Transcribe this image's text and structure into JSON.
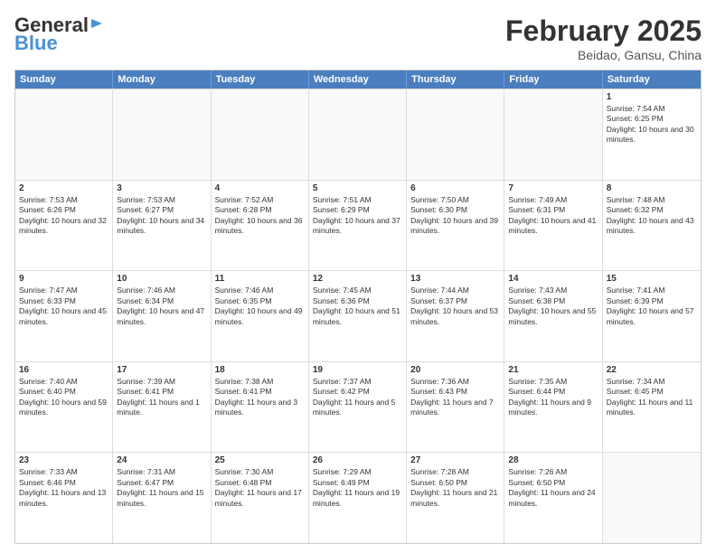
{
  "header": {
    "logo_general": "General",
    "logo_blue": "Blue",
    "month": "February 2025",
    "location": "Beidao, Gansu, China"
  },
  "weekdays": [
    "Sunday",
    "Monday",
    "Tuesday",
    "Wednesday",
    "Thursday",
    "Friday",
    "Saturday"
  ],
  "weeks": [
    [
      {
        "day": "",
        "info": ""
      },
      {
        "day": "",
        "info": ""
      },
      {
        "day": "",
        "info": ""
      },
      {
        "day": "",
        "info": ""
      },
      {
        "day": "",
        "info": ""
      },
      {
        "day": "",
        "info": ""
      },
      {
        "day": "1",
        "info": "Sunrise: 7:54 AM\nSunset: 6:25 PM\nDaylight: 10 hours and 30 minutes."
      }
    ],
    [
      {
        "day": "2",
        "info": "Sunrise: 7:53 AM\nSunset: 6:26 PM\nDaylight: 10 hours and 32 minutes."
      },
      {
        "day": "3",
        "info": "Sunrise: 7:53 AM\nSunset: 6:27 PM\nDaylight: 10 hours and 34 minutes."
      },
      {
        "day": "4",
        "info": "Sunrise: 7:52 AM\nSunset: 6:28 PM\nDaylight: 10 hours and 36 minutes."
      },
      {
        "day": "5",
        "info": "Sunrise: 7:51 AM\nSunset: 6:29 PM\nDaylight: 10 hours and 37 minutes."
      },
      {
        "day": "6",
        "info": "Sunrise: 7:50 AM\nSunset: 6:30 PM\nDaylight: 10 hours and 39 minutes."
      },
      {
        "day": "7",
        "info": "Sunrise: 7:49 AM\nSunset: 6:31 PM\nDaylight: 10 hours and 41 minutes."
      },
      {
        "day": "8",
        "info": "Sunrise: 7:48 AM\nSunset: 6:32 PM\nDaylight: 10 hours and 43 minutes."
      }
    ],
    [
      {
        "day": "9",
        "info": "Sunrise: 7:47 AM\nSunset: 6:33 PM\nDaylight: 10 hours and 45 minutes."
      },
      {
        "day": "10",
        "info": "Sunrise: 7:46 AM\nSunset: 6:34 PM\nDaylight: 10 hours and 47 minutes."
      },
      {
        "day": "11",
        "info": "Sunrise: 7:46 AM\nSunset: 6:35 PM\nDaylight: 10 hours and 49 minutes."
      },
      {
        "day": "12",
        "info": "Sunrise: 7:45 AM\nSunset: 6:36 PM\nDaylight: 10 hours and 51 minutes."
      },
      {
        "day": "13",
        "info": "Sunrise: 7:44 AM\nSunset: 6:37 PM\nDaylight: 10 hours and 53 minutes."
      },
      {
        "day": "14",
        "info": "Sunrise: 7:43 AM\nSunset: 6:38 PM\nDaylight: 10 hours and 55 minutes."
      },
      {
        "day": "15",
        "info": "Sunrise: 7:41 AM\nSunset: 6:39 PM\nDaylight: 10 hours and 57 minutes."
      }
    ],
    [
      {
        "day": "16",
        "info": "Sunrise: 7:40 AM\nSunset: 6:40 PM\nDaylight: 10 hours and 59 minutes."
      },
      {
        "day": "17",
        "info": "Sunrise: 7:39 AM\nSunset: 6:41 PM\nDaylight: 11 hours and 1 minute."
      },
      {
        "day": "18",
        "info": "Sunrise: 7:38 AM\nSunset: 6:41 PM\nDaylight: 11 hours and 3 minutes."
      },
      {
        "day": "19",
        "info": "Sunrise: 7:37 AM\nSunset: 6:42 PM\nDaylight: 11 hours and 5 minutes."
      },
      {
        "day": "20",
        "info": "Sunrise: 7:36 AM\nSunset: 6:43 PM\nDaylight: 11 hours and 7 minutes."
      },
      {
        "day": "21",
        "info": "Sunrise: 7:35 AM\nSunset: 6:44 PM\nDaylight: 11 hours and 9 minutes."
      },
      {
        "day": "22",
        "info": "Sunrise: 7:34 AM\nSunset: 6:45 PM\nDaylight: 11 hours and 11 minutes."
      }
    ],
    [
      {
        "day": "23",
        "info": "Sunrise: 7:33 AM\nSunset: 6:46 PM\nDaylight: 11 hours and 13 minutes."
      },
      {
        "day": "24",
        "info": "Sunrise: 7:31 AM\nSunset: 6:47 PM\nDaylight: 11 hours and 15 minutes."
      },
      {
        "day": "25",
        "info": "Sunrise: 7:30 AM\nSunset: 6:48 PM\nDaylight: 11 hours and 17 minutes."
      },
      {
        "day": "26",
        "info": "Sunrise: 7:29 AM\nSunset: 6:49 PM\nDaylight: 11 hours and 19 minutes."
      },
      {
        "day": "27",
        "info": "Sunrise: 7:28 AM\nSunset: 6:50 PM\nDaylight: 11 hours and 21 minutes."
      },
      {
        "day": "28",
        "info": "Sunrise: 7:26 AM\nSunset: 6:50 PM\nDaylight: 11 hours and 24 minutes."
      },
      {
        "day": "",
        "info": ""
      }
    ]
  ]
}
